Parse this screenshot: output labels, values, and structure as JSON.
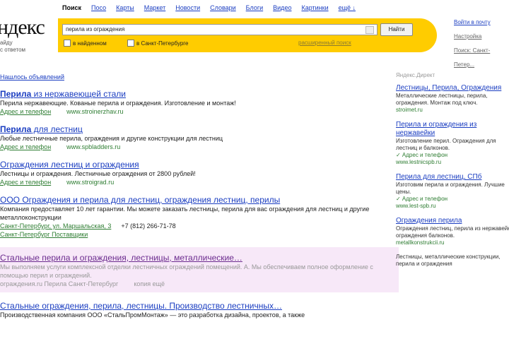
{
  "header": {
    "logo": "ндекс",
    "logo_sub_1": "айду",
    "logo_sub_2": "с ответом",
    "services": [
      {
        "label": "Поиск",
        "current": true
      },
      {
        "label": "Посо"
      },
      {
        "label": "Карты"
      },
      {
        "label": "Маркет"
      },
      {
        "label": "Новости"
      },
      {
        "label": "Словари"
      },
      {
        "label": "Блоги"
      },
      {
        "label": "Видео"
      },
      {
        "label": "Картинки"
      },
      {
        "label": "ещё ↓"
      }
    ]
  },
  "search": {
    "query": "перила из ограждения",
    "button_label": "Найти",
    "option_1": "в найденном",
    "option_2": "в Санкт-Петербурге",
    "advanced_link": "расширенный поиск"
  },
  "right_links": {
    "login": "Войти в почту",
    "settings": "Настройка",
    "region": "Поиск: Санкт-Петер..."
  },
  "results_info": {
    "found": "Нашлось объявлений"
  },
  "results": [
    {
      "title_bold": "Перила",
      "title_rest": " из нержавеющей стали",
      "snippet": "Перила нержавеющие. Кованые перила и ограждения. Изготовление и монтаж!",
      "url_text": "Адрес и телефон",
      "site": "www.stroinerzhav.ru"
    },
    {
      "title_bold": "Перила",
      "title_rest": " для лестниц",
      "snippet": "Любые лестничные перила, ограждения и другие конструкции для лестниц",
      "url_text": "Адрес и телефон",
      "site": "www.spbladders.ru"
    },
    {
      "title_bold": "",
      "title_rest": "Ограждения лестниц и ограждения",
      "snippet": "Лестницы и ограждения. Лестничные ограждения от 2800 рублей!",
      "url_text": "Адрес и телефон",
      "site": "www.stroigrad.ru"
    },
    {
      "title_bold": "",
      "title_rest": "ООО Ограждения и перила для лестниц, ограждения лестниц, перилы",
      "snippet": "Компания предоставляет 10 лет гарантии. Мы можете заказать лестницы, перила для вас ограждения для лестниц и другие металлоконструкции",
      "url_text": "Санкт-Петербург, ул. Маршальская, 3",
      "phone": "+7 (812) 266-71-78",
      "extra": "Санкт-Петербург   Поставщики"
    },
    {
      "visited": true,
      "title_bold": "",
      "title_rest": "Стальные перила и ограждения, лестницы, металлические…",
      "snippet": "Мы выполняем услуги комплексной отделки лестничных ограждений помещений. А. Мы обеспечиваем полное оформление с помощью перил и ограждений.",
      "url_text": "ограждения.ru   Перила   Санкт-Петербург",
      "site": "копия   ещё"
    },
    {
      "title_bold": "",
      "title_rest": "Стальные ограждения, перила, лестницы. Производство лестничных…",
      "snippet": "Производственная компания ООО «СтальПромМонтаж» — это разработка дизайна, проектов, а также",
      "url_text": "",
      "site": ""
    }
  ],
  "ads": {
    "header": "Яндекс.Директ",
    "items": [
      {
        "title": "Лестницы, Перила, Ограждения",
        "snippet": "Металлические лестницы, перила, ограждения. Монтаж под ключ.",
        "url": "stroimet.ru"
      },
      {
        "title": "Перила и ограждения из нержавейки",
        "snippet": "Изготовление перил. Ограждения для лестниц и балконов.",
        "url": "✓ Адрес и телефон",
        "url2": "www.lestnicspb.ru"
      },
      {
        "title": "Перила для лестниц, СПб",
        "snippet": "Изготовим перила и ограждения. Лучшие цены.",
        "url": "✓ Адрес и телефон",
        "url2": "www.lest-spb.ru"
      },
      {
        "title": "Ограждения перила",
        "snippet": "Ограждения лестниц, перила из нержавейки, ограждения балконов.",
        "url": "metallkonstrukcii.ru"
      },
      {
        "title": "",
        "snippet": "Лестницы, металлические конструкции, перила и ограждения",
        "url": ""
      }
    ]
  }
}
